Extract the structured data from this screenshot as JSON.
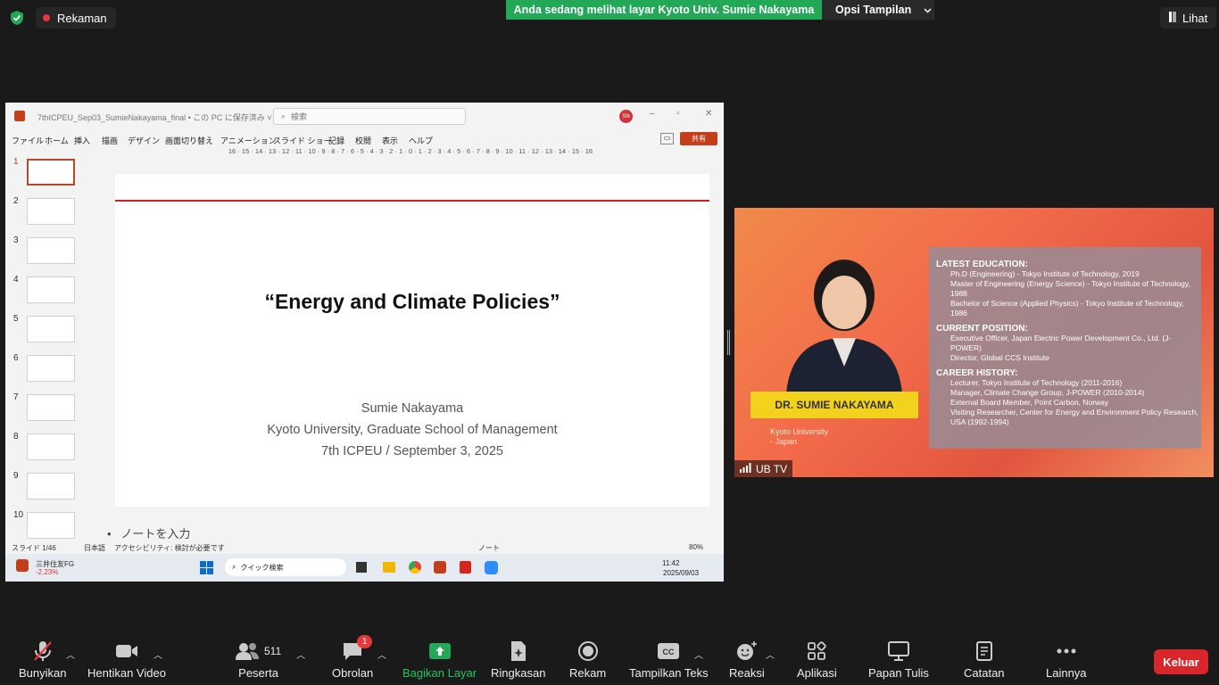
{
  "topbar": {
    "recording_label": "Rekaman",
    "share_banner": "Anda sedang melihat layar Kyoto Univ. Sumie Nakayama",
    "view_options": "Opsi Tampilan",
    "view_label": "Lihat"
  },
  "ppt": {
    "file_name": "7thICPEU_Sep03_SumieNakayama_final • この PC に保存済み ˅",
    "search_placeholder": "検索",
    "user_initials": "SN",
    "menu": [
      "ファイル",
      "ホーム",
      "挿入",
      "描画",
      "デザイン",
      "画面切り替え",
      "アニメーション",
      "スライド ショー",
      "記録",
      "校閲",
      "表示",
      "ヘルプ"
    ],
    "share_label": "共有",
    "ruler": "16 · 15 · 14 · 13 · 12 · 11 · 10 · 9 · 8 · 7 · 6 · 5 · 4 · 3 · 2 · 1 · 0 · 1 · 2 · 3 · 4 · 5 · 6 · 7 · 8 · 9 · 10 · 11 · 12 · 13 · 14 · 15 · 16",
    "thumb_numbers": [
      "1",
      "2",
      "3",
      "4",
      "5",
      "6",
      "7",
      "8",
      "9",
      "10"
    ],
    "slide": {
      "title": "“Energy and Climate Policies”",
      "author": "Sumie Nakayama",
      "affiliation": "Kyoto University, Graduate School of Management",
      "event": "7th ICPEU / September 3, 2025"
    },
    "notes_placeholder": "ノートを入力",
    "status": {
      "slide_count": "スライド 1/46",
      "language": "日本語",
      "accessibility": "アクセシビリティ: 検討が必要です",
      "notes": "ノート",
      "zoom": "80%"
    }
  },
  "taskbar": {
    "stock_name": "三井住友FG",
    "stock_change": "-2.23%",
    "search_placeholder": "クイック検索",
    "time": "11:42",
    "date": "2025/09/03"
  },
  "video": {
    "name_bar": "DR. SUMIE NAKAYAMA",
    "affil_line1": "Kyoto University",
    "affil_line2": "- Japan",
    "label": "UB TV",
    "education_header": "LATEST EDUCATION:",
    "education": [
      "Ph.D (Engineering) - Tokyo Institute of Technology, 2019",
      "Master of Engineering (Energy Science) - Tokyo Institute of Technology, 1988",
      "Bachelor of Science (Applied Physics) - Tokyo Institute of Technology, 1986"
    ],
    "position_header": "CURRENT POSITION:",
    "positions": [
      "Executive Officer, Japan Electric Power Development Co., Ltd. (J-POWER)",
      "Director, Global CCS Institute"
    ],
    "career_header": "CAREER HISTORY:",
    "career": [
      "Lecturer, Tokyo Institute of Technology (2011-2016)",
      "Manager, Climate Change Group, J-POWER (2010-2014)",
      "External Board Member, Point Carbon, Norway",
      "Visiting Researcher, Center for Energy and Environment Policy Research, USA (1992-1994)"
    ]
  },
  "toolbar": {
    "mute": "Bunyikan",
    "video": "Hentikan Video",
    "participants": "Peserta",
    "participants_count": "511",
    "chat": "Obrolan",
    "chat_badge": "1",
    "share": "Bagikan Layar",
    "summary": "Ringkasan",
    "record": "Rekam",
    "captions": "Tampilkan Teks",
    "reactions": "Reaksi",
    "apps": "Aplikasi",
    "whiteboard": "Papan Tulis",
    "notes": "Catatan",
    "more": "Lainnya",
    "leave": "Keluar"
  }
}
